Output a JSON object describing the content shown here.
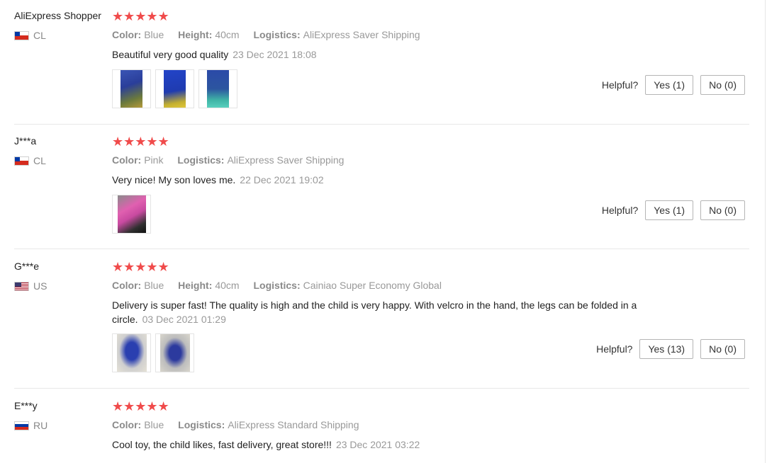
{
  "reviews": [
    {
      "name": "AliExpress Shopper",
      "country": "CL",
      "stars": "★★★★★",
      "attrs": [
        {
          "key": "Color:",
          "value": "Blue"
        },
        {
          "key": "Height:",
          "value": "40cm"
        },
        {
          "key": "Logistics:",
          "value": "AliExpress Saver Shipping"
        }
      ],
      "text": "Beautiful very good quality",
      "date": "23 Dec 2021 18:08",
      "helpful_label": "Helpful?",
      "yes": "Yes (1)",
      "no": "No (0)"
    },
    {
      "name": "J***a",
      "country": "CL",
      "stars": "★★★★★",
      "attrs": [
        {
          "key": "Color:",
          "value": "Pink"
        },
        {
          "key": "Logistics:",
          "value": "AliExpress Saver Shipping"
        }
      ],
      "text": "Very nice! My son loves me.",
      "date": "22 Dec 2021 19:02",
      "helpful_label": "Helpful?",
      "yes": "Yes (1)",
      "no": "No (0)"
    },
    {
      "name": "G***e",
      "country": "US",
      "stars": "★★★★★",
      "attrs": [
        {
          "key": "Color:",
          "value": "Blue"
        },
        {
          "key": "Height:",
          "value": "40cm"
        },
        {
          "key": "Logistics:",
          "value": "Cainiao Super Economy Global"
        }
      ],
      "text": "Delivery is super fast! The quality is high and the child is very happy. With velcro in the hand, the legs can be folded in a circle.",
      "date": "03 Dec 2021 01:29",
      "helpful_label": "Helpful?",
      "yes": "Yes (13)",
      "no": "No (0)"
    },
    {
      "name": "E***y",
      "country": "RU",
      "stars": "★★★★★",
      "attrs": [
        {
          "key": "Color:",
          "value": "Blue"
        },
        {
          "key": "Logistics:",
          "value": "AliExpress Standard Shipping"
        }
      ],
      "text": "Cool toy, the child likes, fast delivery, great store!!!",
      "date": "23 Dec 2021 03:22"
    }
  ],
  "colors": {
    "star": "#f04b4b",
    "muted_text": "#999999",
    "divider": "#e8e8e8"
  }
}
